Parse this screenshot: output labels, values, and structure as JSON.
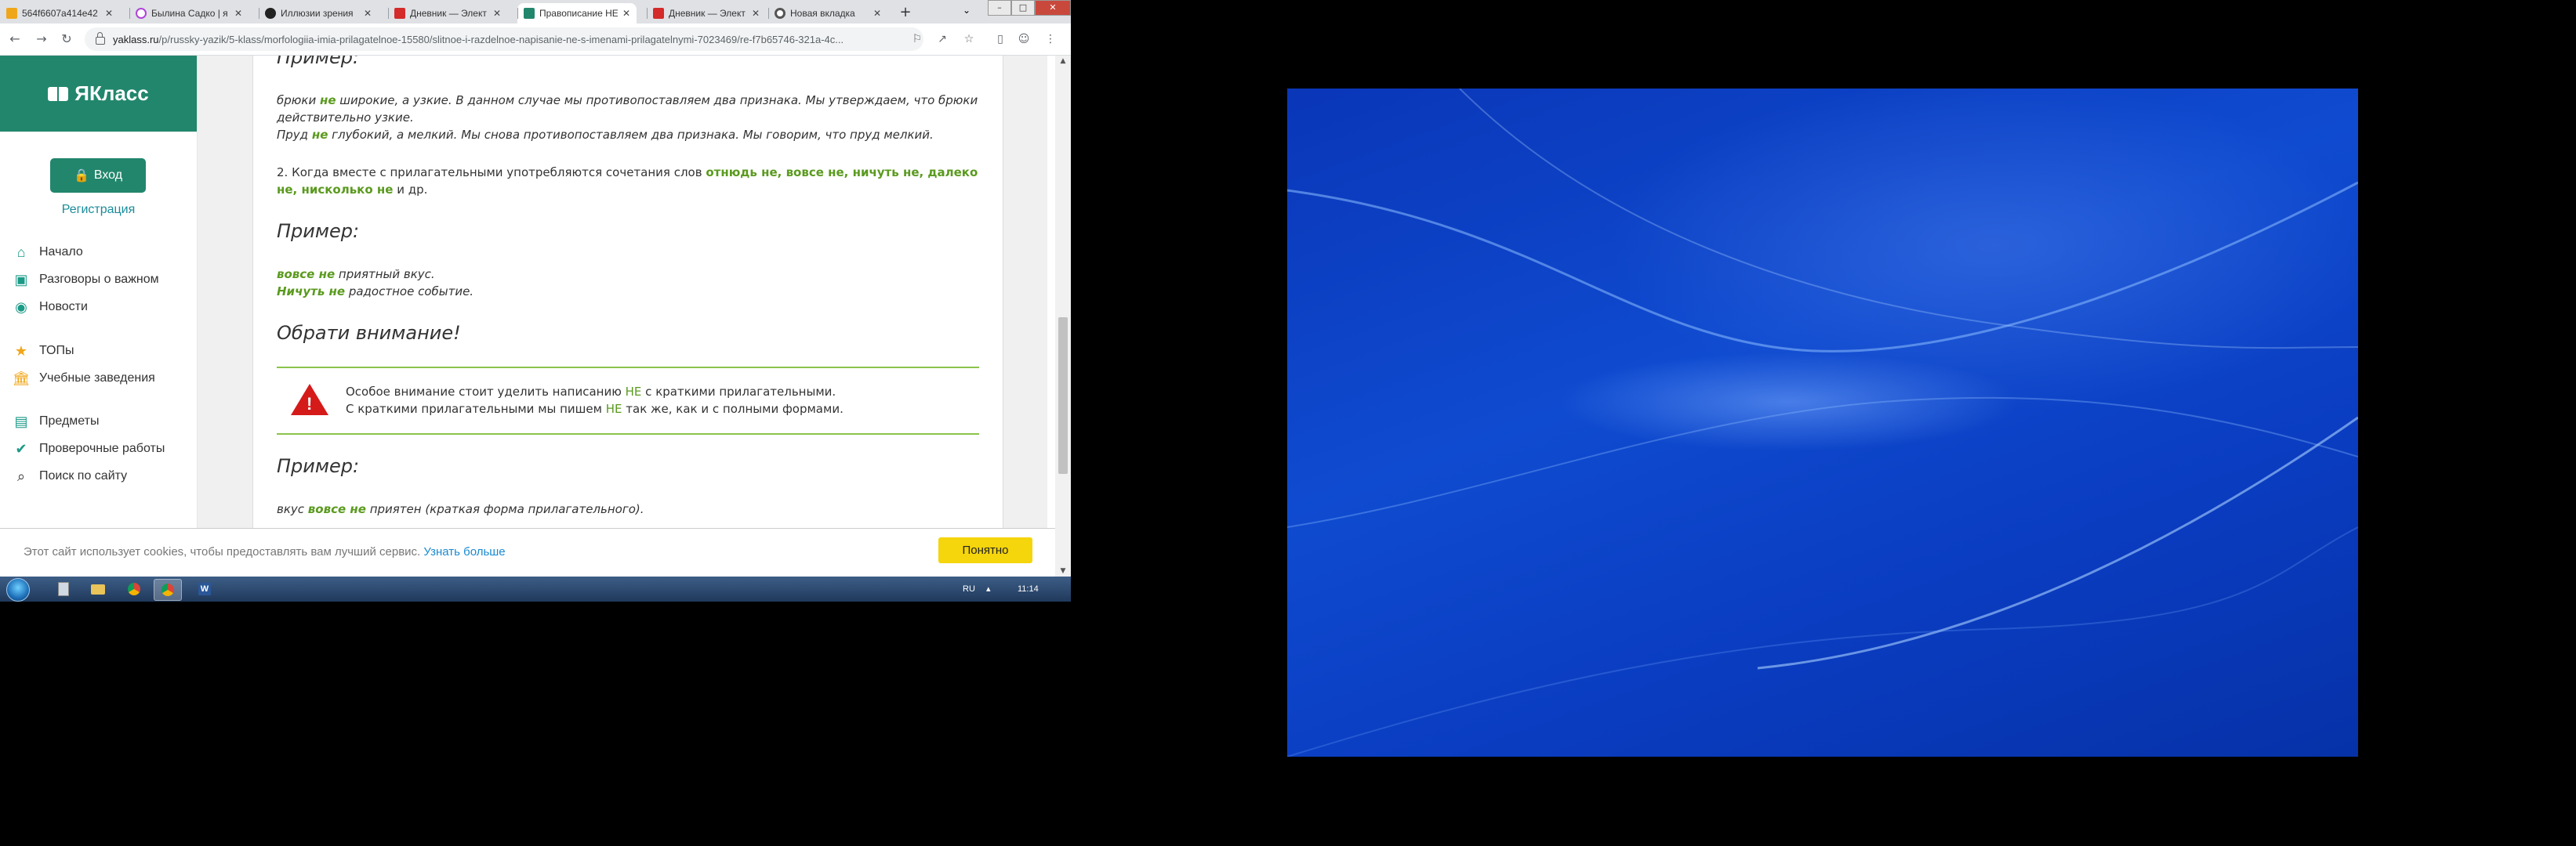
{
  "browser": {
    "tabs": [
      {
        "title": "564f6607a414e42",
        "icon": "orange-document-icon",
        "color": "#f0a61a"
      },
      {
        "title": "Былина Садко | я",
        "icon": "ya-icon",
        "color": "#b044d8"
      },
      {
        "title": "Иллюзии зрения",
        "icon": "dark-circle-icon",
        "color": "#222222"
      },
      {
        "title": "Дневник — Элект",
        "icon": "red-d-icon",
        "color": "#d42a2a"
      },
      {
        "title": "Правописание НЕ",
        "icon": "yaklass-book-icon",
        "color": "#22866c"
      },
      {
        "title": "Дневник — Элект",
        "icon": "red-d-icon",
        "color": "#d42a2a"
      },
      {
        "title": "Новая вкладка",
        "icon": "chrome-icon",
        "color": "#555555"
      }
    ],
    "active_tab": 4,
    "url_host": "yaklass.ru",
    "url_path": "/p/russky-yazik/5-klass/morfologiia-imia-prilagatelnoe-15580/slitnoe-i-razdelnoe-napisanie-ne-s-imenami-prilagatelnymi-7023469/re-f7b65746-321a-4c..."
  },
  "sidebar": {
    "logo": "ЯКласс",
    "login": "Вход",
    "register": "Регистрация",
    "items": [
      {
        "label": "Начало",
        "icon": "home-icon"
      },
      {
        "label": "Разговоры о важном",
        "icon": "screen-icon"
      },
      {
        "label": "Новости",
        "icon": "news-icon"
      },
      {
        "label": "ТОПы",
        "icon": "star-icon"
      },
      {
        "label": "Учебные заведения",
        "icon": "building-icon"
      },
      {
        "label": "Предметы",
        "icon": "books-icon"
      },
      {
        "label": "Проверочные работы",
        "icon": "check-icon"
      },
      {
        "label": "Поиск по сайту",
        "icon": "search-icon"
      }
    ]
  },
  "article": {
    "h_example1": "Пример:",
    "ex1_line1_pre": "брюки ",
    "ex1_line1_ne": "не",
    "ex1_line1_post": " широкие, а узкие. В данном случае мы противопоставляем два признака. Мы утверждаем, что брюки действительно узкие.",
    "ex1_line2_pre": "Пруд ",
    "ex1_line2_ne": "не",
    "ex1_line2_post": " глубокий, а мелкий. Мы снова противопоставляем два признака. Мы говорим, что пруд мелкий.",
    "rule2_pre": "2. Когда вместе с прилагательными употребляются сочетания слов ",
    "rule2_words": "отнюдь не, вовсе не, ничуть не, далеко не, нисколько не",
    "rule2_post": " и др.",
    "h_example2": "Пример:",
    "ex2_line1_hl": "вовсе не",
    "ex2_line1_rest": " приятный вкус.",
    "ex2_line2_hl": "Ничуть не",
    "ex2_line2_rest": " радостное событие.",
    "h_attention": "Обрати внимание!",
    "note_line1_pre": "Особое внимание стоит уделить написанию ",
    "note_line1_ne": "НЕ",
    "note_line1_post": " с краткими прилагательными.",
    "note_line2_pre": "С краткими прилагательными мы пишем ",
    "note_line2_ne": "НЕ",
    "note_line2_post": " так же, как и с полными формами.",
    "h_example3": "Пример:",
    "ex3_pre": "вкус ",
    "ex3_hl": "вовсе не",
    "ex3_post": " приятен (краткая форма прилагательного)."
  },
  "cookie": {
    "text": "Этот сайт использует cookies, чтобы предоставлять вам лучший сервис.",
    "link": "Узнать больше",
    "button": "Понятно"
  },
  "taskbar": {
    "lang": "RU",
    "time": "11:14"
  }
}
